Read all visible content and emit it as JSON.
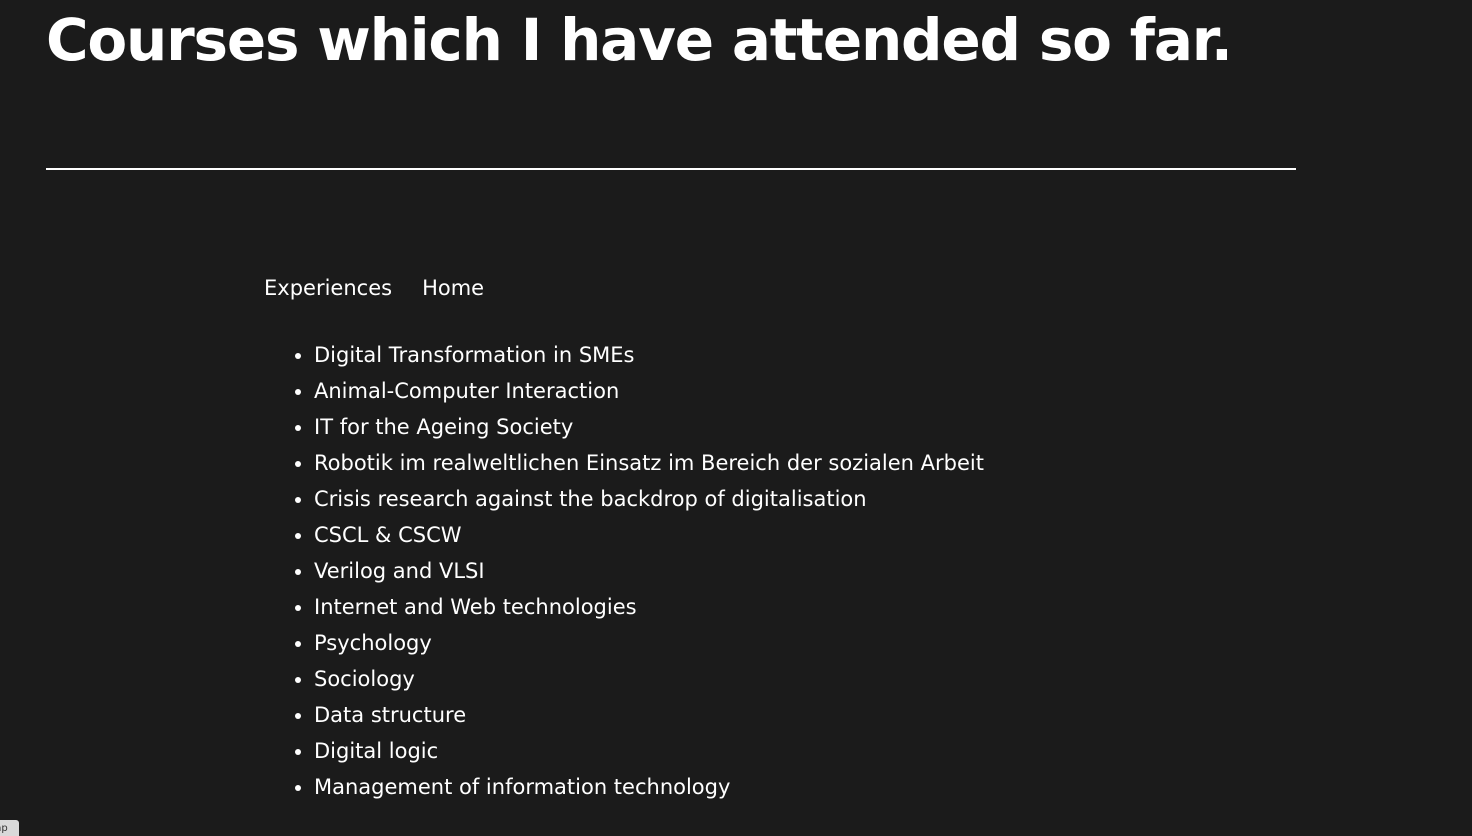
{
  "page": {
    "title": "Courses which I have attended so far."
  },
  "nav": {
    "items": [
      {
        "label": "Experiences"
      },
      {
        "label": "Home"
      }
    ]
  },
  "courses": {
    "items": [
      {
        "label": "Digital Transformation in SMEs"
      },
      {
        "label": "Animal-Computer Interaction"
      },
      {
        "label": "IT for the Ageing Society"
      },
      {
        "label": "Robotik im realweltlichen Einsatz im Bereich der sozialen Arbeit"
      },
      {
        "label": "Crisis research against the backdrop of digitalisation"
      },
      {
        "label": "CSCL & CSCW"
      },
      {
        "label": "Verilog and VLSI"
      },
      {
        "label": "Internet and Web technologies"
      },
      {
        "label": "Psychology"
      },
      {
        "label": "Sociology"
      },
      {
        "label": "Data structure"
      },
      {
        "label": "Digital logic"
      },
      {
        "label": "Management of information technology"
      }
    ]
  },
  "corner_tab": {
    "label": "hp"
  },
  "colors": {
    "background": "#1b1b1b",
    "text": "#ffffff",
    "divider": "#ffffff"
  }
}
